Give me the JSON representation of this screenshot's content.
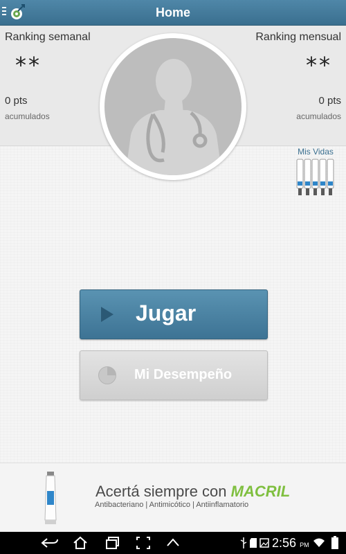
{
  "appbar": {
    "title": "Home"
  },
  "ranking": {
    "weekly": {
      "title": "Ranking semanal",
      "value": "**",
      "points": "0 pts",
      "caption": "acumulados"
    },
    "monthly": {
      "title": "Ranking mensual",
      "value": "**",
      "points": "0 pts",
      "caption": "acumulados"
    }
  },
  "lives": {
    "label": "Mis Vidas",
    "count": 5
  },
  "actions": {
    "play_label": "Jugar",
    "performance_label": "Mi Desempeño"
  },
  "ad": {
    "tagline": "Acertá siempre con",
    "brand": "MACRIL",
    "subtitle": "Antibacteriano | Antimicótico | Antiinflamatorio"
  },
  "status_bar": {
    "time": "2:56",
    "ampm": "PM",
    "icons": [
      "usb-icon",
      "sd-icon",
      "image-icon",
      "wifi-icon",
      "battery-icon"
    ]
  },
  "nav_bar": {
    "icons": [
      "back-icon",
      "home-icon",
      "recents-icon",
      "screenshot-icon",
      "menu-up-icon"
    ]
  },
  "colors": {
    "primary": "#3d7394",
    "accent": "#7fbf3f"
  }
}
